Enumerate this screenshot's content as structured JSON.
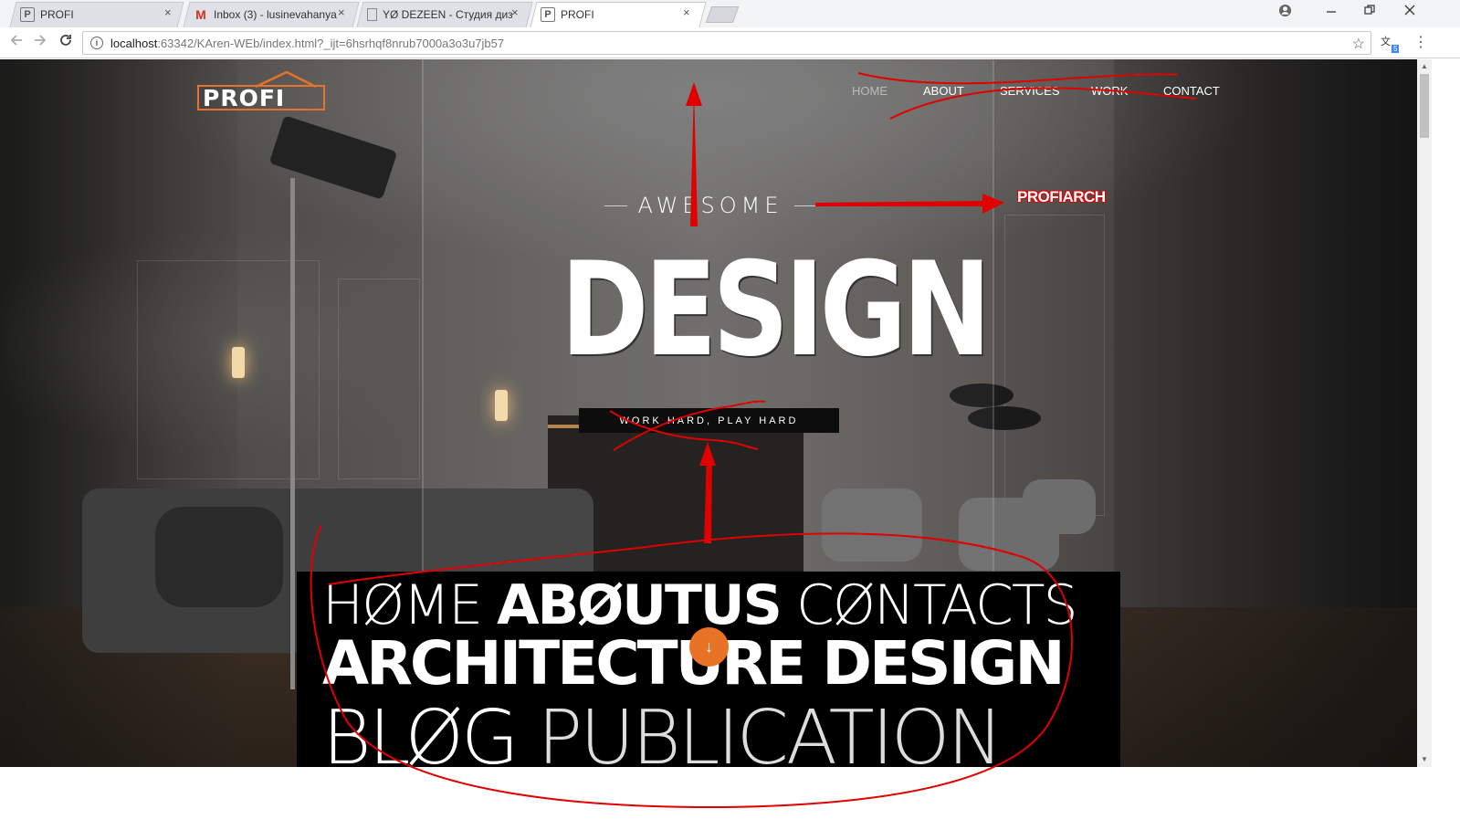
{
  "browser": {
    "tabs": [
      {
        "title": "PROFI",
        "favicon": "profi-favicon-icon",
        "active": false
      },
      {
        "title": "Inbox (3) - lusinevahanya",
        "favicon": "gmail-icon",
        "active": false
      },
      {
        "title": "YØ DEZEEN - Студия диз",
        "favicon": "document-icon",
        "active": false
      },
      {
        "title": "PROFI",
        "favicon": "profi-favicon-icon",
        "active": true
      }
    ],
    "close_glyph": "×",
    "url_host": "localhost",
    "url_rest": ":63342/KAren-WEb/index.html?_ijt=6hsrhqf8nrub7000a3o3u7jb57",
    "extension_badge": "5"
  },
  "site": {
    "logo_text": "PROFI",
    "nav": [
      "HOME",
      "ABOUT",
      "SERVICES",
      "WORK",
      "CONTACT"
    ],
    "hero": {
      "eyebrow": "AWESOME",
      "headline": "DESIGN",
      "tagline": "WORK HARD, PLAY HARD"
    },
    "word_cloud": {
      "line1": [
        "HØME",
        "ABØUTUS",
        "CØNTACTS"
      ],
      "line2": [
        "ARCHITECTURE",
        "DESIGN"
      ],
      "line3": [
        "BLØG",
        "PUBLICATION"
      ]
    },
    "scroll_arrow": "↓"
  },
  "annotation": {
    "label": "PROFIARCH",
    "color": "#e00000"
  },
  "colors": {
    "accent_orange": "#e8722a",
    "annotation_red": "#e00000"
  }
}
